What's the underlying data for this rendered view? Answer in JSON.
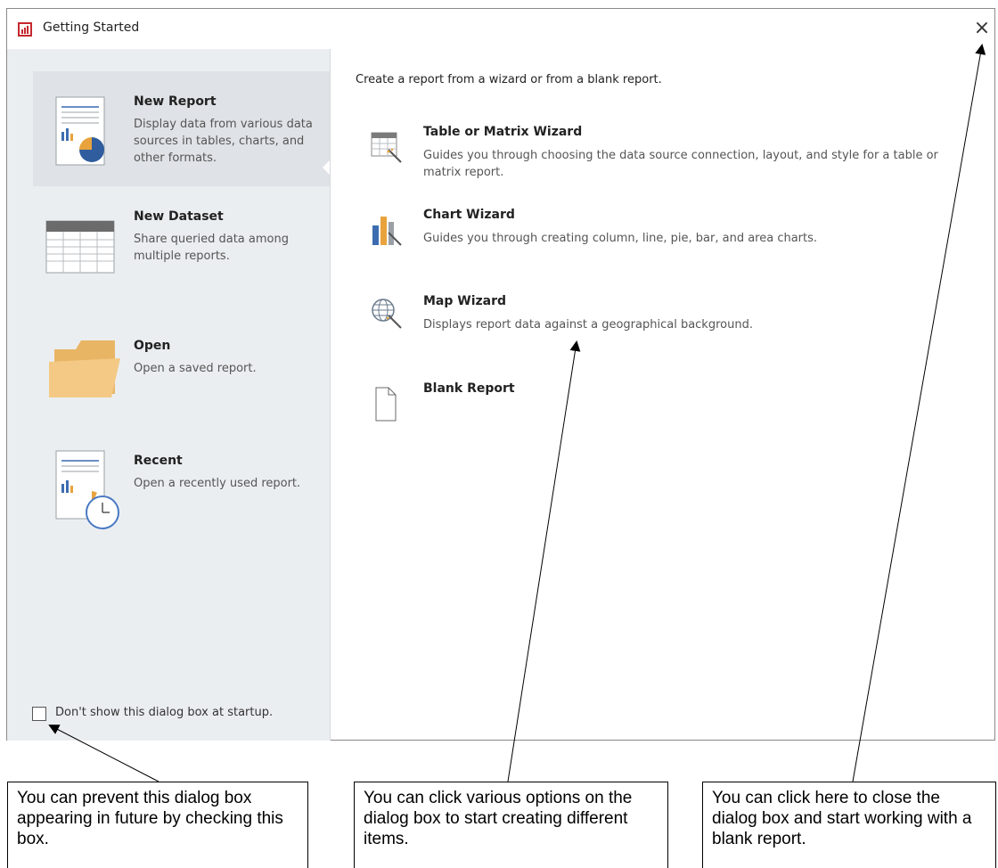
{
  "window": {
    "title": "Getting Started",
    "close_label": "×"
  },
  "sidebar": {
    "items": [
      {
        "title": "New Report",
        "desc": "Display data from various data sources in tables, charts, and other formats.",
        "icon": "report-chart-icon"
      },
      {
        "title": "New Dataset",
        "desc": "Share queried data among multiple reports.",
        "icon": "dataset-table-icon"
      },
      {
        "title": "Open",
        "desc": "Open a saved report.",
        "icon": "folder-icon"
      },
      {
        "title": "Recent",
        "desc": "Open a recently used report.",
        "icon": "recent-report-clock-icon"
      }
    ],
    "startup_checkbox_label": "Don't show this dialog box at startup."
  },
  "main": {
    "intro": "Create a report from a wizard or from a blank report.",
    "wizards": [
      {
        "title": "Table or Matrix Wizard",
        "desc": "Guides you through choosing the data source connection, layout, and style for a table or matrix report.",
        "icon": "table-wizard-icon"
      },
      {
        "title": "Chart Wizard",
        "desc": "Guides you through creating column, line, pie, bar, and area charts.",
        "icon": "chart-wizard-icon"
      },
      {
        "title": "Map Wizard",
        "desc": "Displays report data against a geographical background.",
        "icon": "map-wizard-icon"
      },
      {
        "title": "Blank Report",
        "desc": "",
        "icon": "blank-page-icon"
      }
    ]
  },
  "callouts": [
    "You can prevent this dialog box appearing in future by checking this box.",
    "You can click various options on the dialog box to start creating different items.",
    "You can click here to close the dialog box and start working with a blank report."
  ],
  "colors": {
    "sidebar_bg": "#ebeef1",
    "selected_bg": "#dfe2e6",
    "title_icon_red": "#c5282d",
    "folder": "#f0c27b"
  }
}
